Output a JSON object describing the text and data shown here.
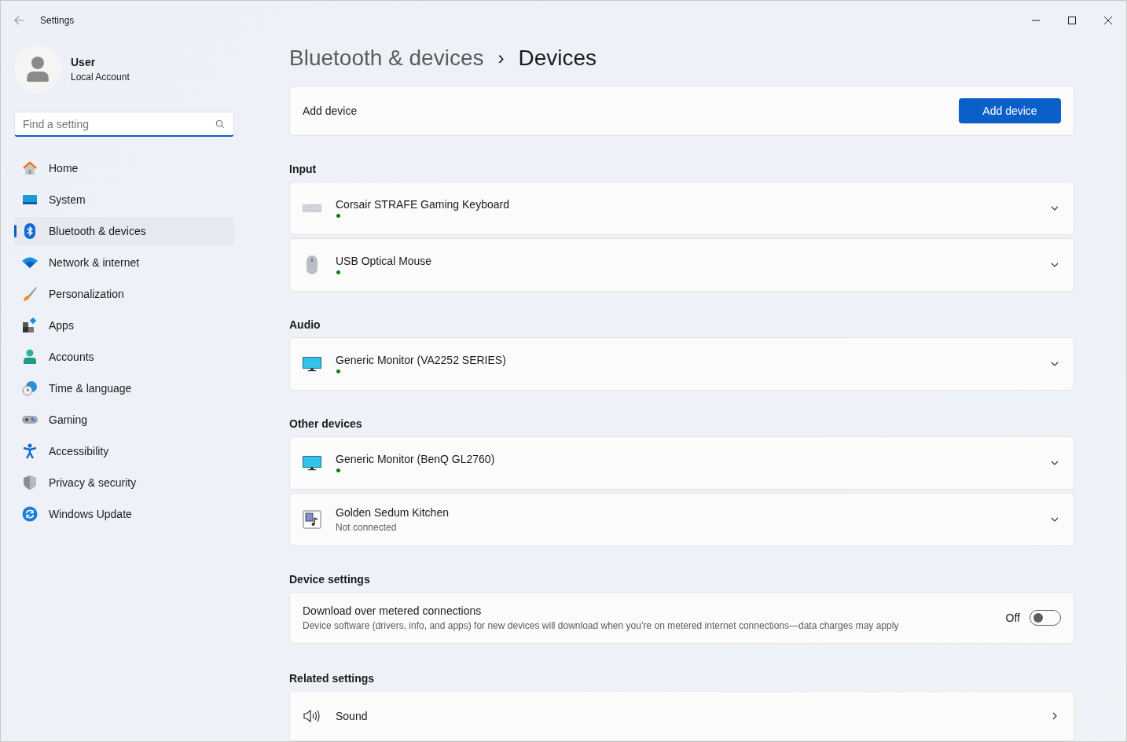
{
  "window": {
    "title": "Settings"
  },
  "profile": {
    "name": "User",
    "account": "Local Account"
  },
  "search": {
    "placeholder": "Find a setting"
  },
  "nav": [
    {
      "label": "Home",
      "kind": "home",
      "selected": false
    },
    {
      "label": "System",
      "kind": "system",
      "selected": false
    },
    {
      "label": "Bluetooth & devices",
      "kind": "bluetooth",
      "selected": true
    },
    {
      "label": "Network & internet",
      "kind": "wifi",
      "selected": false
    },
    {
      "label": "Personalization",
      "kind": "brush",
      "selected": false
    },
    {
      "label": "Apps",
      "kind": "apps",
      "selected": false
    },
    {
      "label": "Accounts",
      "kind": "person",
      "selected": false
    },
    {
      "label": "Time & language",
      "kind": "globe",
      "selected": false
    },
    {
      "label": "Gaming",
      "kind": "gamepad",
      "selected": false
    },
    {
      "label": "Accessibility",
      "kind": "accessibility",
      "selected": false
    },
    {
      "label": "Privacy & security",
      "kind": "shield",
      "selected": false
    },
    {
      "label": "Windows Update",
      "kind": "update",
      "selected": false
    }
  ],
  "breadcrumb": {
    "parent": "Bluetooth & devices",
    "separator": "›",
    "current": "Devices"
  },
  "add_device": {
    "label": "Add device",
    "button": "Add device"
  },
  "sections": [
    {
      "title": "Input",
      "devices": [
        {
          "name": "Corsair STRAFE Gaming Keyboard",
          "kind": "keyboard",
          "connected": true
        },
        {
          "name": "USB Optical Mouse",
          "kind": "mouse",
          "connected": true
        }
      ]
    },
    {
      "title": "Audio",
      "devices": [
        {
          "name": "Generic Monitor (VA2252 SERIES)",
          "kind": "monitor",
          "connected": true
        }
      ]
    },
    {
      "title": "Other devices",
      "devices": [
        {
          "name": "Generic Monitor (BenQ GL2760)",
          "kind": "monitor",
          "connected": true
        },
        {
          "name": "Golden Sedum Kitchen",
          "kind": "media",
          "connected": false,
          "status": "Not connected"
        }
      ]
    }
  ],
  "device_settings": {
    "title": "Device settings",
    "setting": {
      "label": "Download over metered connections",
      "description": "Device software (drivers, info, and apps) for new devices will download when you’re on metered internet connections—data charges may apply",
      "state_label": "Off",
      "on": false
    }
  },
  "related": {
    "title": "Related settings",
    "items": [
      {
        "label": "Sound"
      }
    ]
  }
}
